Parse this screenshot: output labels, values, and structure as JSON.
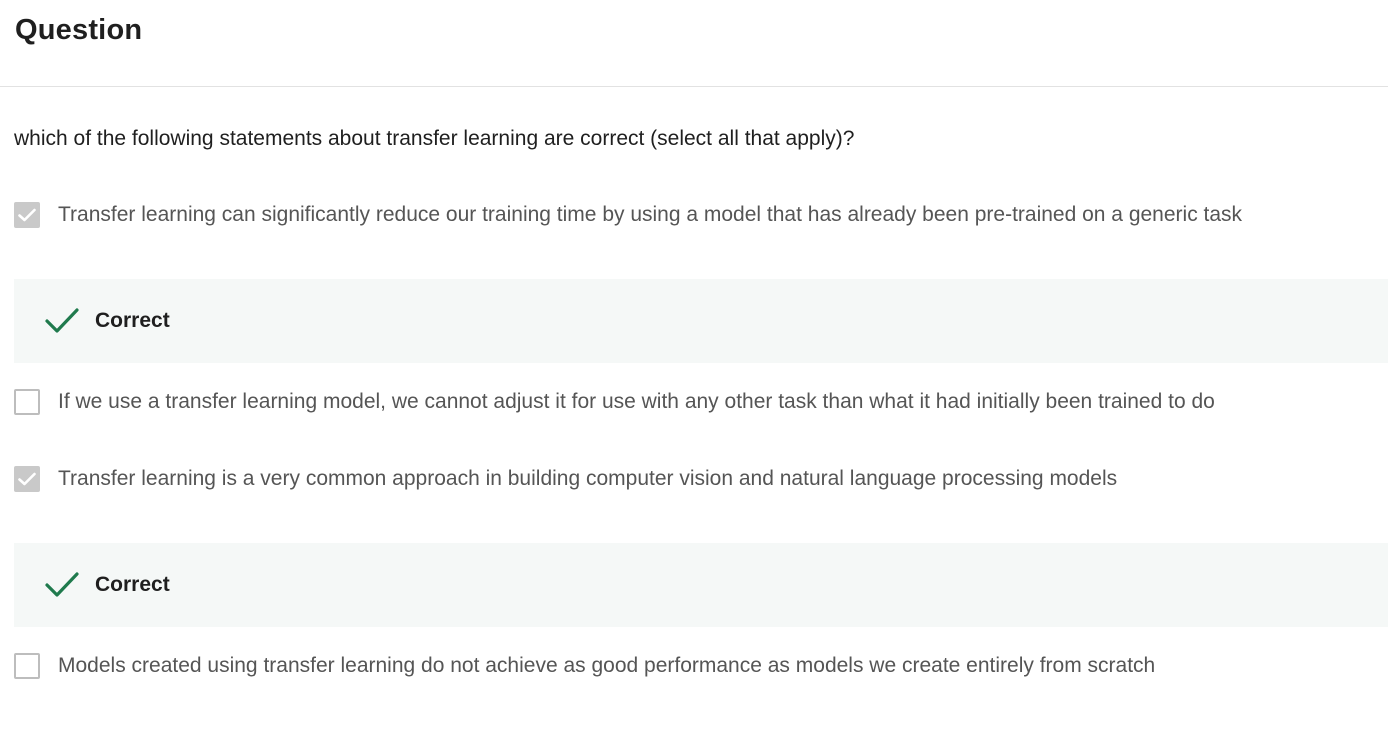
{
  "header": {
    "title": "Question"
  },
  "question": {
    "prompt": "which of the following statements about transfer learning are correct (select all that apply)?"
  },
  "options": [
    {
      "label": "Transfer learning can significantly reduce our training time by using a model that has already been pre-trained on a generic task",
      "checked": true,
      "feedback": "Correct"
    },
    {
      "label": "If we use a transfer learning model, we cannot adjust it for use with any other task than what it had initially been trained to do",
      "checked": false
    },
    {
      "label": "Transfer learning is a very common approach in building computer vision and natural language processing models",
      "checked": true,
      "feedback": "Correct"
    },
    {
      "label": "Models created using transfer learning do not achieve as good performance as models we create entirely from scratch",
      "checked": false
    }
  ],
  "colors": {
    "correct_check": "#1f7a4d",
    "feedback_background": "#f5f8f7",
    "checkbox_checked": "#c9c9c9",
    "checkbox_border": "#bdbdbd"
  },
  "icons": {
    "checkbox_checked": "checkmark-icon",
    "feedback": "checkmark-icon"
  }
}
